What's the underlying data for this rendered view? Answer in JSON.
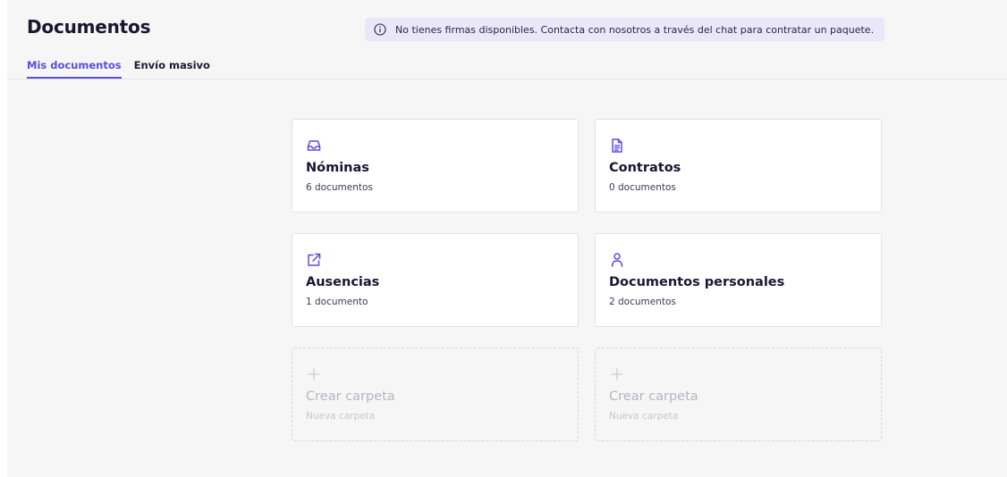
{
  "header": {
    "title": "Documentos",
    "banner_text": "No tienes firmas disponibles. Contacta con nosotros a través del chat para contratar un paquete.",
    "banner_icon": "info-icon"
  },
  "tabs": [
    {
      "label": "Mis documentos",
      "active": true
    },
    {
      "label": "Envío masivo",
      "active": false
    }
  ],
  "folders": [
    {
      "icon": "inbox-icon",
      "title": "Nóminas",
      "count": "6 documentos"
    },
    {
      "icon": "document-icon",
      "title": "Contratos",
      "count": "0 documentos"
    },
    {
      "icon": "external-link-icon",
      "title": "Ausencias",
      "count": "1 documento"
    },
    {
      "icon": "user-icon",
      "title": "Documentos personales",
      "count": "2 documentos"
    }
  ],
  "create_folder": [
    {
      "icon": "plus-icon",
      "title": "Crear carpeta",
      "subtitle": "Nueva carpeta"
    },
    {
      "icon": "plus-icon",
      "title": "Crear carpeta",
      "subtitle": "Nueva carpeta"
    }
  ],
  "colors": {
    "accent": "#5a4de0",
    "banner_bg": "#e9e7fa",
    "panel_bg": "#f6f6f7"
  }
}
